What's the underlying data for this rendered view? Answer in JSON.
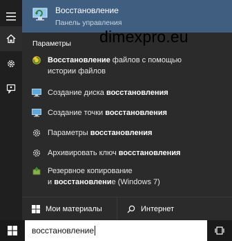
{
  "best_match": {
    "title": "Восстановление",
    "subtitle": "Панель управления",
    "icon": "recovery-monitor-icon"
  },
  "watermark": "dimexpro.eu",
  "section_label": "Параметры",
  "results": [
    {
      "pre": "",
      "bold": "Восстановление",
      "post": " файлов с помощью",
      "line2_pre": "истории файлов",
      "line2_bold": "",
      "line2_post": "",
      "icon": "file-history-icon"
    },
    {
      "pre": "Создание диска ",
      "bold": "восстановления",
      "post": "",
      "icon": "monitor-icon"
    },
    {
      "pre": "Создание точки ",
      "bold": "восстановления",
      "post": "",
      "icon": "monitor-icon"
    },
    {
      "pre": "Параметры ",
      "bold": "восстановления",
      "post": "",
      "icon": "gear-icon"
    },
    {
      "pre": "Архивировать ключ ",
      "bold": "восстановления",
      "post": "",
      "icon": "gear-icon"
    },
    {
      "pre": "Резервное копирование",
      "bold": "",
      "post": "",
      "line2_pre": "и ",
      "line2_bold": "восстановлени",
      "line2_post": "е (Windows 7)",
      "icon": "backup-restore-icon"
    }
  ],
  "tabs": {
    "mine": "Мои материалы",
    "web": "Интернет"
  },
  "search": {
    "value": "восстановление"
  },
  "colors": {
    "accent": "#3f5e80",
    "panel": "#2b2b2b",
    "sidebar": "#1f1f1f"
  }
}
